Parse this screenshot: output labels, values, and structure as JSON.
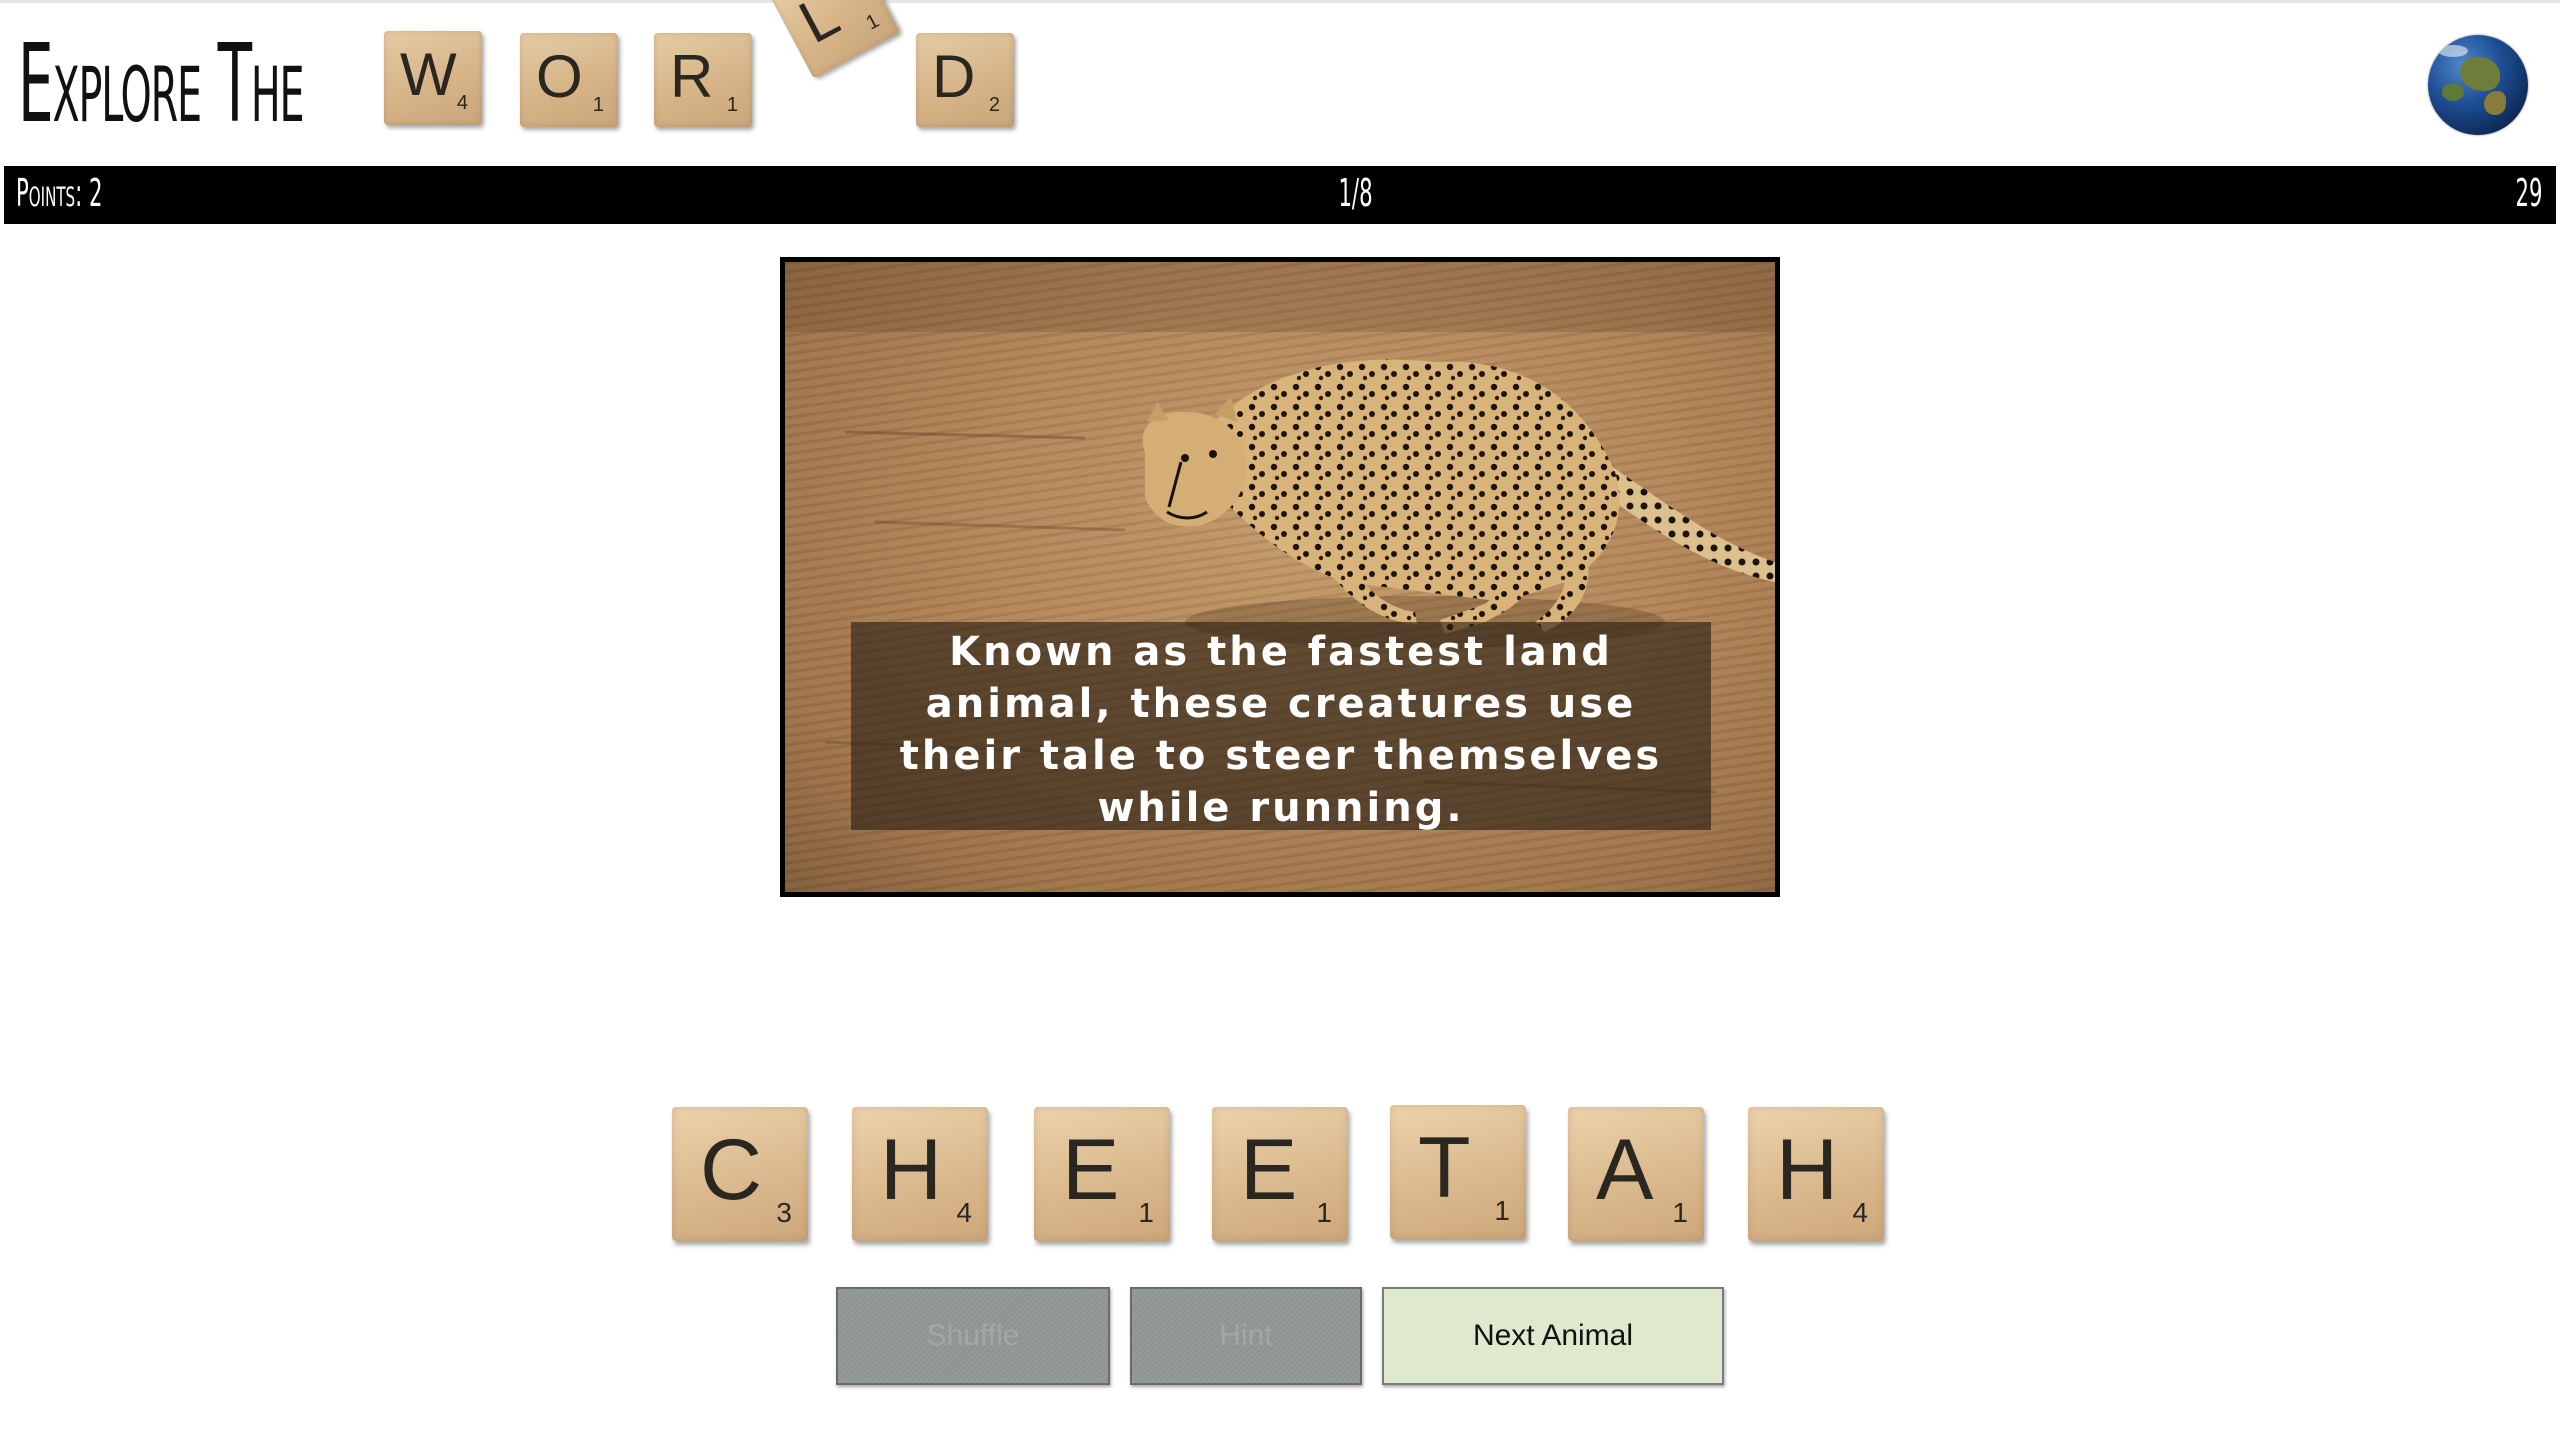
{
  "header": {
    "title_prefix": "Explore The",
    "title_tiles": [
      {
        "letter": "W",
        "points": "4"
      },
      {
        "letter": "O",
        "points": "1"
      },
      {
        "letter": "R",
        "points": "1"
      },
      {
        "letter": "L",
        "points": "1"
      },
      {
        "letter": "D",
        "points": "2"
      }
    ]
  },
  "status": {
    "points": "Points: 2",
    "progress": "1/8",
    "timer": "29"
  },
  "clue": {
    "text": "Known as the fastest land animal, these creatures use their tale to steer themselves while running."
  },
  "answer_tiles": [
    {
      "letter": "C",
      "points": "3"
    },
    {
      "letter": "H",
      "points": "4"
    },
    {
      "letter": "E",
      "points": "1"
    },
    {
      "letter": "E",
      "points": "1"
    },
    {
      "letter": "T",
      "points": "1"
    },
    {
      "letter": "A",
      "points": "1"
    },
    {
      "letter": "H",
      "points": "4"
    }
  ],
  "buttons": {
    "shuffle": "Shuffle",
    "hint": "Hint",
    "next": "Next Animal"
  },
  "colors": {
    "status_bar": "#000000",
    "next_button": "#dfe9cd",
    "disabled_button": "#8d9390",
    "tile_wood": "#dcbb90"
  },
  "icons": {
    "globe": "earth-globe-icon"
  }
}
